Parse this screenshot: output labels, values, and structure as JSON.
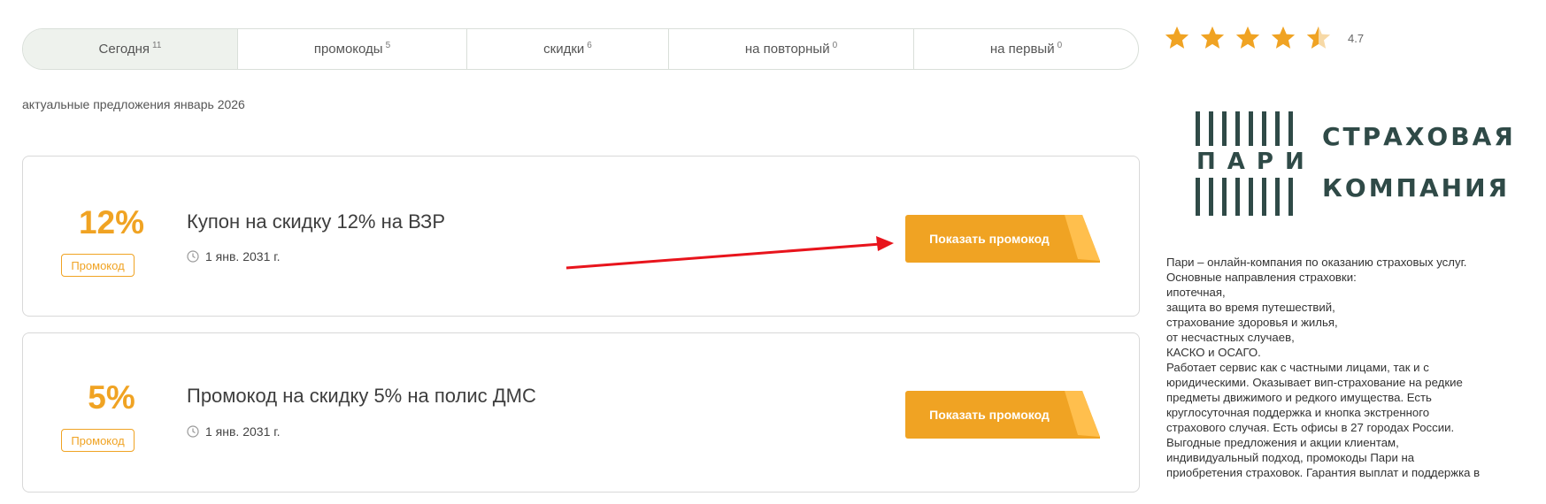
{
  "tabs": [
    {
      "label": "Сегодня",
      "count": "11"
    },
    {
      "label": "промокоды",
      "count": "5"
    },
    {
      "label": "скидки",
      "count": "6"
    },
    {
      "label": "на повторный",
      "count": "0"
    },
    {
      "label": "на первый",
      "count": "0"
    }
  ],
  "subtitle": "актуальные предложения январь 2026",
  "offers": [
    {
      "percent": "12%",
      "badge": "Промокод",
      "title": "Купон на скидку 12% на ВЗР",
      "date": "1 янв. 2031 г.",
      "button": "Показать промокод"
    },
    {
      "percent": "5%",
      "badge": "Промокод",
      "title": "Промокод на скидку 5% на полис ДМС",
      "date": "1 янв. 2031 г.",
      "button": "Показать промокод"
    }
  ],
  "rating": {
    "value": "4.7",
    "stars": 4.7
  },
  "logo": {
    "word": "ПАРИ",
    "line1": "СТРАХОВАЯ",
    "line2": "КОМПАНИЯ"
  },
  "description": [
    "Пари – онлайн-компания по оказанию страховых услуг.",
    "Основные направления страховки:",
    "ипотечная,",
    "защита во время путешествий,",
    "страхование здоровья и жилья,",
    "от несчастных случаев,",
    "КАСКО и ОСАГО.",
    "Работает сервис как с частными лицами, так и с",
    "юридическими. Оказывает вип-страхование на редкие",
    "предметы движимого и редкого имущества. Есть",
    "круглосуточная поддержка и кнопка экстренного",
    "страхового случая. Есть офисы в 27 городах России.",
    "Выгодные предложения и акции клиентам,",
    "индивидуальный подход, промокоды Пари на",
    "приобретения страховок. Гарантия выплат и поддержка в"
  ],
  "colors": {
    "accent": "#f0a323",
    "accent_light": "#ffbf4d",
    "brand": "#2f4a47",
    "arrow": "#e8141c",
    "tab_active_bg": "#eef2ed"
  }
}
